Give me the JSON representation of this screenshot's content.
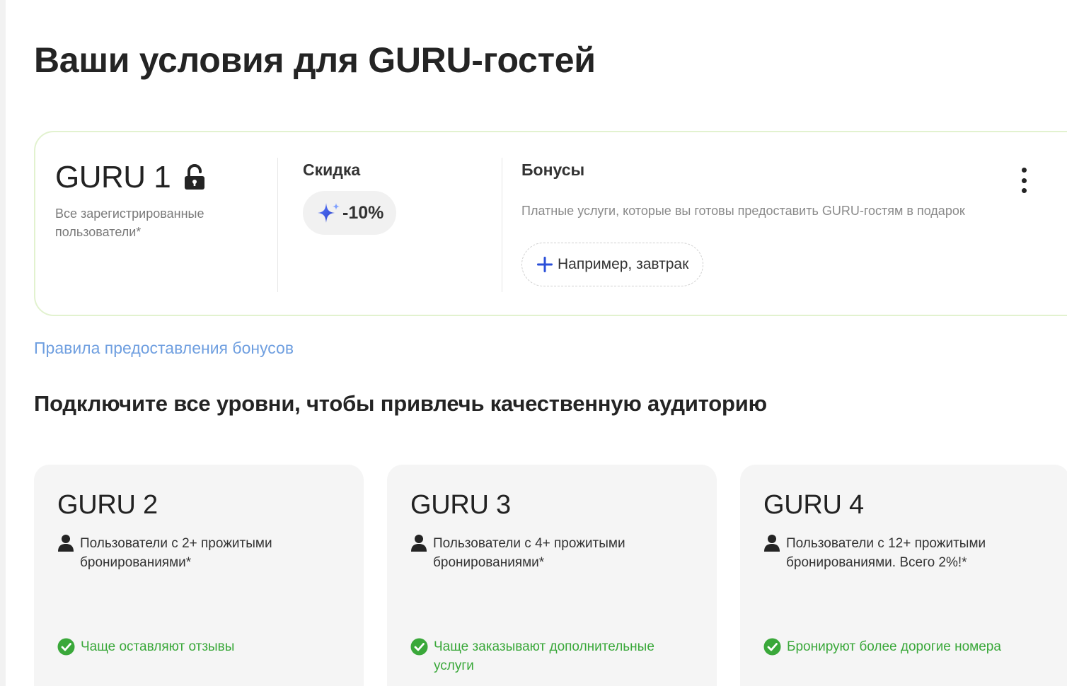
{
  "page": {
    "title": "Ваши условия для GURU-гостей"
  },
  "guru1": {
    "name": "GURU 1",
    "description": "Все зарегистрированные пользователи*",
    "discount_heading": "Скидка",
    "discount_value": "-10%",
    "bonus_heading": "Бонусы",
    "bonus_subtitle": "Платные услуги, которые вы готовы предоставить GURU-гостям в подарок",
    "add_bonus_placeholder": "Например, завтрак",
    "icons": {
      "lock": "lock-open-icon",
      "sparkle": "sparkle-icon",
      "plus": "plus-icon",
      "more": "more-vertical-icon"
    }
  },
  "rules_link": "Правила предоставления бонусов",
  "tiers_section": {
    "title": "Подключите все уровни, чтобы привлечь качественную аудиторию",
    "tiers": [
      {
        "name": "GURU 2",
        "audience": "Пользователи с 2+ прожитыми бронированиями*",
        "benefit": "Чаще оставляют отзывы"
      },
      {
        "name": "GURU 3",
        "audience": "Пользователи с 4+ прожитыми бронированиями*",
        "benefit": "Чаще заказывают дополнительные услуги"
      },
      {
        "name": "GURU 4",
        "audience": "Пользователи с 12+ прожитыми бронированиями. Всего 2%!*",
        "benefit": "Бронируют более дорогие номера"
      }
    ]
  },
  "colors": {
    "card_border": "#e2f2cf",
    "link": "#6f9fe0",
    "success": "#3aa83a",
    "accent_blue": "#2a4fd8",
    "tier_bg": "#f5f5f5"
  }
}
